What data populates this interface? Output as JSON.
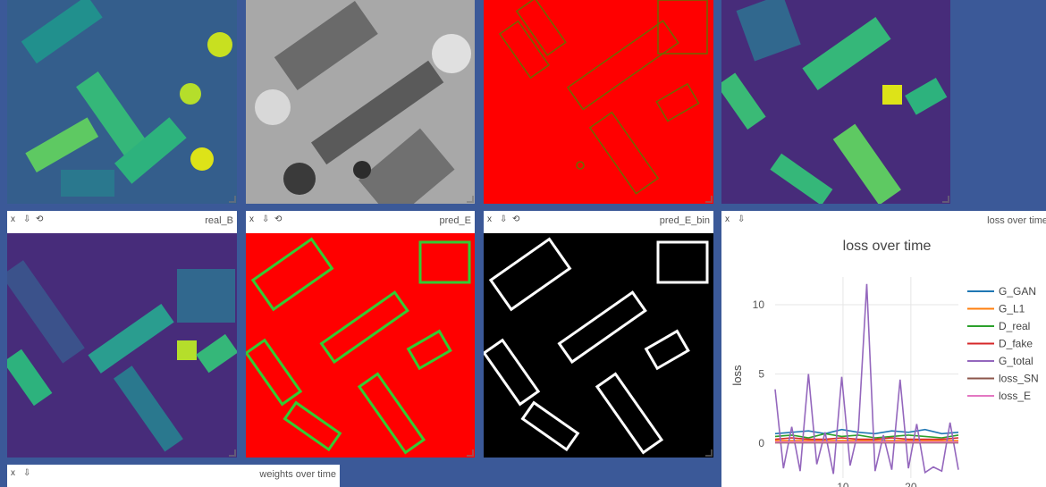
{
  "panes": {
    "top1": {
      "title": ""
    },
    "top2": {
      "title": ""
    },
    "top3": {
      "title": ""
    },
    "top4": {
      "title": ""
    },
    "realB": {
      "title": "real_B"
    },
    "predE": {
      "title": "pred_E"
    },
    "predEbin": {
      "title": "pred_E_bin"
    },
    "loss": {
      "title": "loss over time"
    },
    "weights": {
      "title": "weights over time"
    }
  },
  "controls": {
    "close": "x",
    "save": "⇩",
    "reset": "⟲"
  },
  "colors": {
    "background": "#3b5998",
    "viridis_bg": "#472c7a",
    "red_mask": "#ff0000",
    "green_edge": "#33cc33"
  },
  "chart_data": {
    "type": "line",
    "title": "loss over time",
    "xlabel": "",
    "ylabel": "loss",
    "xlim": [
      0,
      27
    ],
    "ylim": [
      -2.5,
      12
    ],
    "xticks": [
      10,
      20
    ],
    "yticks": [
      0,
      5,
      10
    ],
    "grid": true,
    "legend_position": "right",
    "series": [
      {
        "name": "G_GAN",
        "color": "#1f77b4",
        "values": [
          0.7,
          0.8,
          0.9,
          0.7,
          1.0,
          0.8,
          0.7,
          0.9,
          0.8,
          1.0,
          0.7,
          0.8
        ]
      },
      {
        "name": "G_L1",
        "color": "#ff7f0e",
        "values": [
          0.2,
          0.2,
          0.2,
          0.2,
          0.2,
          0.2,
          0.2,
          0.2,
          0.2,
          0.2,
          0.2,
          0.2
        ]
      },
      {
        "name": "D_real",
        "color": "#2ca02c",
        "values": [
          0.5,
          0.6,
          0.4,
          0.7,
          0.5,
          0.6,
          0.4,
          0.5,
          0.6,
          0.5,
          0.4,
          0.6
        ]
      },
      {
        "name": "D_fake",
        "color": "#d62728",
        "values": [
          0.3,
          0.4,
          0.3,
          0.3,
          0.4,
          0.3,
          0.3,
          0.4,
          0.3,
          0.3,
          0.3,
          0.4
        ]
      },
      {
        "name": "G_total",
        "color": "#9467bd",
        "values": [
          3.9,
          -1.8,
          1.2,
          -2.0,
          5.0,
          -1.5,
          0.8,
          -2.2,
          4.8,
          -1.6,
          1.0,
          11.5,
          -2.0,
          0.6,
          -1.9,
          4.6,
          -1.8,
          1.4,
          -2.1,
          -1.7,
          -2.0,
          1.5,
          -1.9
        ]
      },
      {
        "name": "loss_SN",
        "color": "#8c564b",
        "values": [
          0.05,
          0.05,
          0.05,
          0.05,
          0.05,
          0.05,
          0.05,
          0.05,
          0.05,
          0.05,
          0.05,
          0.05
        ]
      },
      {
        "name": "loss_E",
        "color": "#e377c2",
        "values": [
          0.1,
          0.1,
          0.1,
          0.1,
          0.1,
          0.1,
          0.1,
          0.1,
          0.1,
          0.1,
          0.1,
          0.1
        ]
      }
    ]
  }
}
